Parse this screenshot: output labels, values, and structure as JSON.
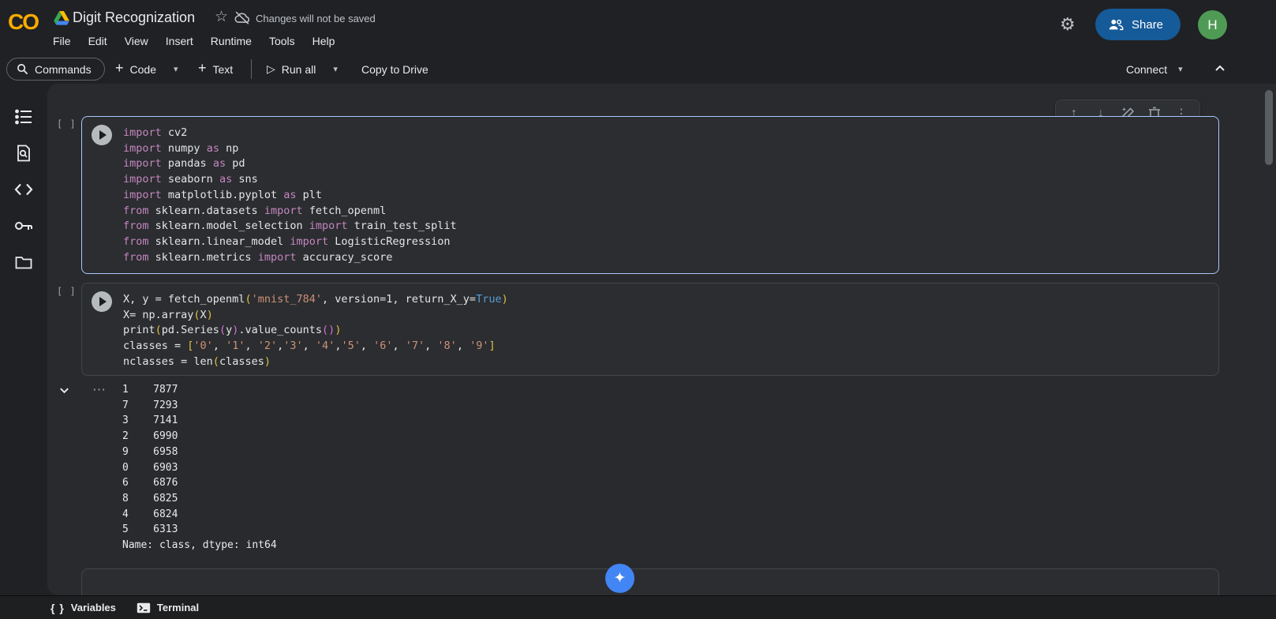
{
  "colors": {
    "logo_orange": "#f9ab00",
    "share_blue": "#155a99",
    "avatar_green": "#4f9b55",
    "gemini_blue": "#4285f4",
    "focused_cell_border": "#a8c7fa"
  },
  "header": {
    "logo_text": "CO",
    "title": "Digit Recognization",
    "save_status": "Changes will not be saved",
    "menus": [
      "File",
      "Edit",
      "View",
      "Insert",
      "Runtime",
      "Tools",
      "Help"
    ],
    "share_label": "Share",
    "avatar_initial": "H"
  },
  "toolbar": {
    "commands_label": "Commands",
    "add_code_label": "Code",
    "add_text_label": "Text",
    "run_all_label": "Run all",
    "copy_to_drive_label": "Copy to Drive",
    "connect_label": "Connect"
  },
  "sidebar_icon_names": [
    "table-of-contents",
    "find-and-replace",
    "code-snippets",
    "secrets",
    "files"
  ],
  "icons": {
    "star": "☆",
    "gear": "⚙",
    "plus": "+",
    "caret_down": "▾",
    "play_outline": "▷",
    "arrow_up": "↑",
    "arrow_down": "↓",
    "more_vert": "⋮",
    "more_horiz": "⋯",
    "braces": "{ }",
    "spark": "✦"
  },
  "cells": [
    {
      "execution_label": "[ ]",
      "lines": [
        [
          [
            "import",
            "kw"
          ],
          [
            " cv2",
            "pl"
          ]
        ],
        [
          [
            "import",
            "kw"
          ],
          [
            " numpy ",
            "pl"
          ],
          [
            "as",
            "kw"
          ],
          [
            " np",
            "pl"
          ]
        ],
        [
          [
            "import",
            "kw"
          ],
          [
            " pandas ",
            "pl"
          ],
          [
            "as",
            "kw"
          ],
          [
            " pd",
            "pl"
          ]
        ],
        [
          [
            "import",
            "kw"
          ],
          [
            " seaborn ",
            "pl"
          ],
          [
            "as",
            "kw"
          ],
          [
            " sns",
            "pl"
          ]
        ],
        [
          [
            "import",
            "kw"
          ],
          [
            " matplotlib.pyplot ",
            "pl"
          ],
          [
            "as",
            "kw"
          ],
          [
            " plt",
            "pl"
          ]
        ],
        [
          [
            "from",
            "kw"
          ],
          [
            " sklearn.datasets ",
            "pl"
          ],
          [
            "import",
            "kw"
          ],
          [
            " fetch_openml",
            "pl"
          ]
        ],
        [
          [
            "from",
            "kw"
          ],
          [
            " sklearn.model_selection ",
            "pl"
          ],
          [
            "import",
            "kw"
          ],
          [
            " train_test_split",
            "pl"
          ]
        ],
        [
          [
            "from",
            "kw"
          ],
          [
            " sklearn.linear_model ",
            "pl"
          ],
          [
            "import",
            "kw"
          ],
          [
            " LogisticRegression",
            "pl"
          ]
        ],
        [
          [
            "from",
            "kw"
          ],
          [
            " sklearn.metrics ",
            "pl"
          ],
          [
            "import",
            "kw"
          ],
          [
            " accuracy_score",
            "pl"
          ]
        ]
      ]
    },
    {
      "execution_label": "[ ]",
      "lines": [
        [
          [
            "X, y = fetch_openml",
            "pl"
          ],
          [
            "(",
            "b1"
          ],
          [
            "'mnist_784'",
            "str"
          ],
          [
            ", version=1, return_X_y=",
            "pl"
          ],
          [
            "True",
            "bool"
          ],
          [
            ")",
            "b1"
          ]
        ],
        [
          [
            "X= np.array",
            "pl"
          ],
          [
            "(",
            "b1"
          ],
          [
            "X",
            "pl"
          ],
          [
            ")",
            "b1"
          ]
        ],
        [
          [
            "print",
            "pl"
          ],
          [
            "(",
            "b1"
          ],
          [
            "pd.Series",
            "pl"
          ],
          [
            "(",
            "b2"
          ],
          [
            "y",
            "pl"
          ],
          [
            ")",
            "b2"
          ],
          [
            ".value_counts",
            "pl"
          ],
          [
            "(",
            "b2"
          ],
          [
            ")",
            "b2"
          ],
          [
            ")",
            "b1"
          ]
        ],
        [
          [
            "classes = ",
            "pl"
          ],
          [
            "[",
            "b1"
          ],
          [
            "'0'",
            "str"
          ],
          [
            ", ",
            "pl"
          ],
          [
            "'1'",
            "str"
          ],
          [
            ", ",
            "pl"
          ],
          [
            "'2'",
            "str"
          ],
          [
            ",",
            "pl"
          ],
          [
            "'3'",
            "str"
          ],
          [
            ", ",
            "pl"
          ],
          [
            "'4'",
            "str"
          ],
          [
            ",",
            "pl"
          ],
          [
            "'5'",
            "str"
          ],
          [
            ", ",
            "pl"
          ],
          [
            "'6'",
            "str"
          ],
          [
            ", ",
            "pl"
          ],
          [
            "'7'",
            "str"
          ],
          [
            ", ",
            "pl"
          ],
          [
            "'8'",
            "str"
          ],
          [
            ", ",
            "pl"
          ],
          [
            "'9'",
            "str"
          ],
          [
            "]",
            "b1"
          ]
        ],
        [
          [
            "nclasses = len",
            "pl"
          ],
          [
            "(",
            "b1"
          ],
          [
            "classes",
            "pl"
          ],
          [
            ")",
            "b1"
          ]
        ]
      ]
    }
  ],
  "output": {
    "lines": [
      "1    7877",
      "7    7293",
      "3    7141",
      "2    6990",
      "9    6958",
      "0    6903",
      "6    6876",
      "8    6825",
      "4    6824",
      "5    6313",
      "Name: class, dtype: int64"
    ]
  },
  "bottombar": {
    "variables_label": "Variables",
    "terminal_label": "Terminal"
  }
}
